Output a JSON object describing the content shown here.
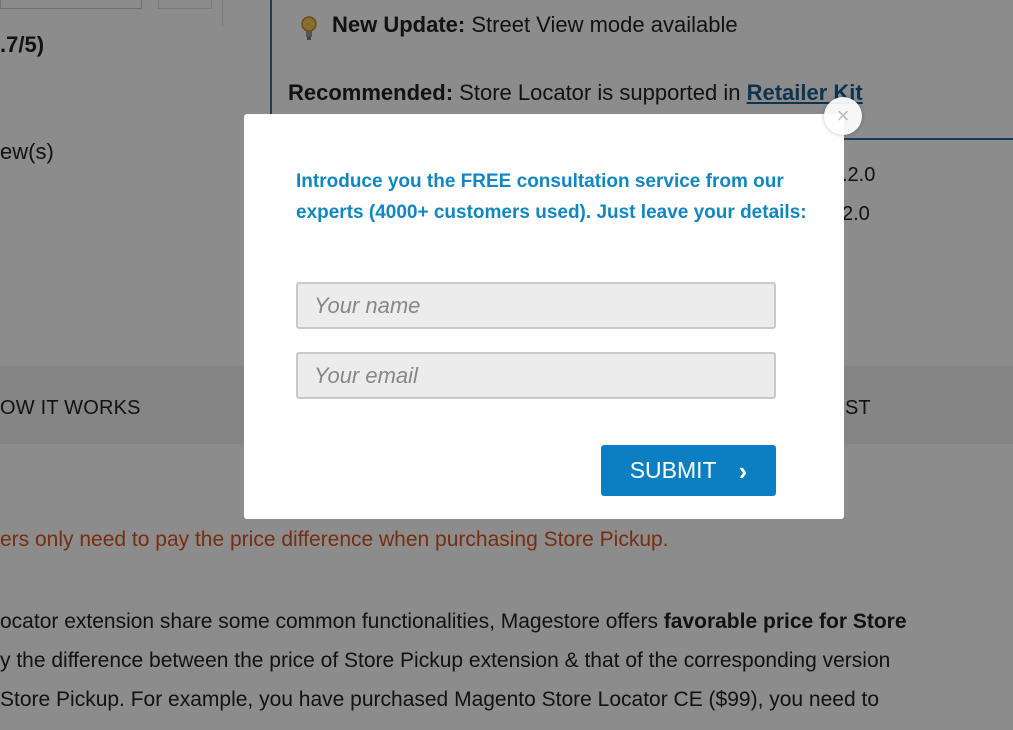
{
  "background": {
    "rating_fragment": ".7/5)",
    "reviews_fragment": "ew(s)",
    "update": {
      "label": "New Update:",
      "text": "Street View mode available"
    },
    "recommended": {
      "label": "Recommended:",
      "text": "Store Locator is supported in",
      "link": "Retailer Kit"
    },
    "versions": [
      ".2.0",
      "2.0"
    ],
    "tabs": {
      "how_it_works": "OW IT WORKS",
      "right_fragment": "ST"
    },
    "note": "ers only need to pay the price difference when purchasing Store Pickup.",
    "paragraph": {
      "line1_prefix": "ocator extension share some common functionalities, Magestore offers ",
      "line1_bold": "favorable price for Store",
      "line2": "y the difference between the price of Store Pickup extension & that of the corresponding version",
      "line3": " Store Pickup. For example, you have purchased Magento Store Locator CE ($99), you need to"
    }
  },
  "modal": {
    "intro": "Introduce you the FREE consultation service from our experts (4000+ customers used). Just leave your details:",
    "name_placeholder": "Your name",
    "email_placeholder": "Your email",
    "submit_label": "SUBMIT",
    "submit_chevron": "›",
    "close_glyph": "×"
  },
  "colors": {
    "accent": "#0b7fc1",
    "intro_text": "#1186c0",
    "note_orange": "#d9531e",
    "link": "#1a5d8f"
  },
  "icons": [
    "lightbulb-icon",
    "chevron-right-icon",
    "close-icon"
  ]
}
